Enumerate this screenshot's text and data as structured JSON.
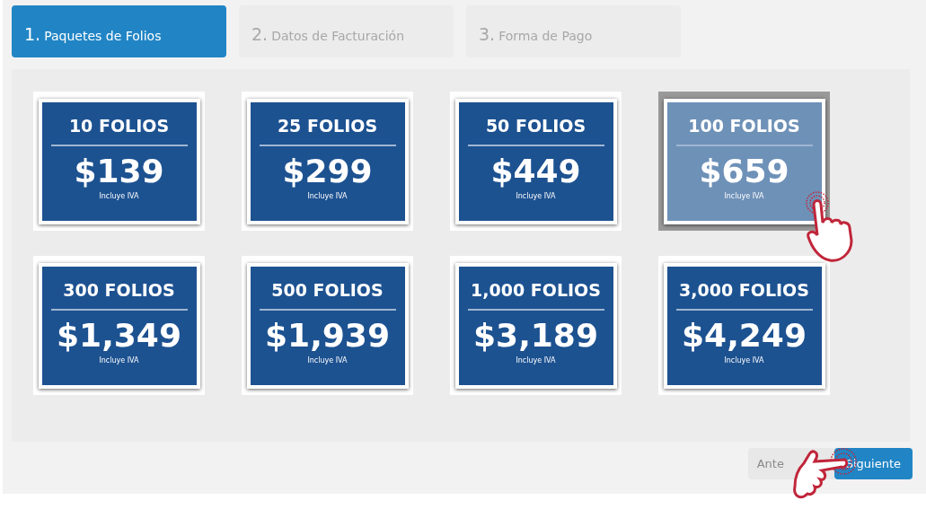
{
  "steps": [
    {
      "number": "1.",
      "label": "Paquetes de Folios",
      "selected": true
    },
    {
      "number": "2.",
      "label": "Datos de Facturación",
      "selected": false
    },
    {
      "number": "3.",
      "label": "Forma de Pago",
      "selected": false
    }
  ],
  "packages": [
    {
      "title": "10 FOLIOS",
      "price": "$139",
      "note": "Incluye IVA",
      "selected": false
    },
    {
      "title": "25 FOLIOS",
      "price": "$299",
      "note": "Incluye IVA",
      "selected": false
    },
    {
      "title": "50 FOLIOS",
      "price": "$449",
      "note": "Incluye IVA",
      "selected": false
    },
    {
      "title": "100 FOLIOS",
      "price": "$659",
      "note": "Incluye IVA",
      "selected": true
    },
    {
      "title": "300 FOLIOS",
      "price": "$1,349",
      "note": "Incluye IVA",
      "selected": false
    },
    {
      "title": "500 FOLIOS",
      "price": "$1,939",
      "note": "Incluye IVA",
      "selected": false
    },
    {
      "title": "1,000 FOLIOS",
      "price": "$3,189",
      "note": "Incluye IVA",
      "selected": false
    },
    {
      "title": "3,000 FOLIOS",
      "price": "$4,249",
      "note": "Incluye IVA",
      "selected": false
    }
  ],
  "buttons": {
    "previous": {
      "label": "Ante",
      "disabled": true
    },
    "next": {
      "label": "Siguiente",
      "disabled": false
    }
  }
}
